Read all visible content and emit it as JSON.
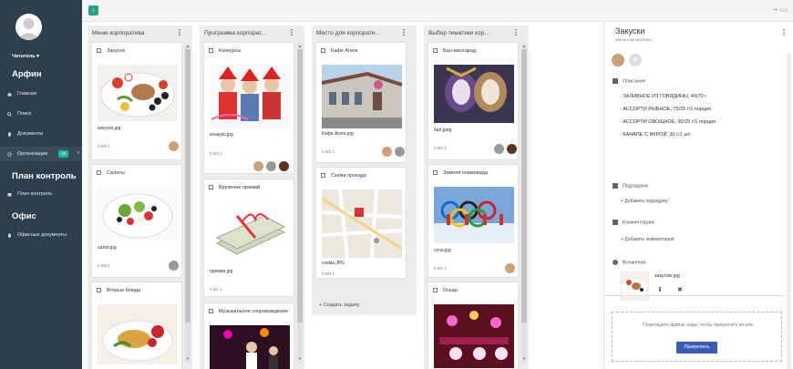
{
  "sidebar": {
    "user_role": "Читатель",
    "user_caret": "▾",
    "sections": [
      {
        "title": "Арфин"
      },
      {
        "title": "План контроль"
      },
      {
        "title": "Офис"
      }
    ],
    "items": [
      {
        "label": "Главная",
        "icon": "home-icon"
      },
      {
        "label": "Поиск",
        "icon": "search-icon"
      },
      {
        "label": "Документы",
        "icon": "document-icon"
      },
      {
        "label": "Организации",
        "icon": "organization-icon",
        "badge": "19"
      },
      {
        "label": "План контроль",
        "icon": "calendar-icon"
      },
      {
        "label": "Офисные документы",
        "icon": "file-icon"
      }
    ],
    "color": "#2d3e4c"
  },
  "topbar": {
    "back_glyph": "‹",
    "exit_label": "Exit",
    "accent": "#2aa08a"
  },
  "columns": [
    {
      "title": "Меню корпоратива",
      "cards": [
        {
          "title": "Закуски",
          "file": "закуски.jpg",
          "stats": "0   0/0   1"
        },
        {
          "title": "Салаты",
          "file": "салат.jpg",
          "stats": "0   0/0   1"
        },
        {
          "title": "Вторые блюда",
          "file": "",
          "stats": ""
        }
      ]
    },
    {
      "title": "Программа корпорат...",
      "cards": [
        {
          "title": "Конкурсы",
          "file": "конкурс.jpg",
          "stats": "0   0/0   1"
        },
        {
          "title": "Вручение премий",
          "file": "премия.jpg",
          "stats": "0   0/1   1"
        },
        {
          "title": "Музыкальное сопровождение",
          "file": "",
          "stats": ""
        }
      ]
    },
    {
      "title": "Место для корпорати...",
      "cards": [
        {
          "title": "Кафе Агата",
          "file": "Кафе Агата.jpg",
          "stats": "0   0/2   1"
        },
        {
          "title": "Схема проезда",
          "file": "схема.JPG",
          "stats": "0   0/0   1"
        }
      ],
      "add_task": "+ Создать задачу"
    },
    {
      "title": "Выбор тематики кор...",
      "cards": [
        {
          "title": "Бал-маскарад",
          "file": "бал.jpeg",
          "stats": "0   0/0   1"
        },
        {
          "title": "Зимняя олимпиада",
          "file": "сочи.jpg",
          "stats": "0   0/0   1"
        },
        {
          "title": "Оскар",
          "file": "",
          "stats": ""
        }
      ]
    }
  ],
  "panel": {
    "title": "Закуски",
    "subtitle": "Меню корпоратива",
    "menu_glyph": "⋮",
    "description_title": "Описание",
    "description_lines": [
      "- ЗАЛИВНОЕ ИЗ ГОВЯДИНЫ, 40/70 г",
      "- АССОРТИ РЫБНОЕ, 75/25 г/1 порция",
      "- АССОРТИ ОВОЩНОЕ, 90/15 г/1 порция",
      "- КАНАПЕ С ИКРОЙ, 30 г/1 шт."
    ],
    "subtasks_title": "Подзадачи",
    "add_subtask": "+ Добавить подзадачу",
    "comments_title": "Комментарии",
    "add_comment": "+ Добавить комментарий",
    "attachments_title": "Вложения",
    "attachment_file": "закуски.jpg",
    "drop_text": "Перетащите файлы сюда, чтобы прикрепить их или",
    "attach_button": "Прикрепить"
  }
}
